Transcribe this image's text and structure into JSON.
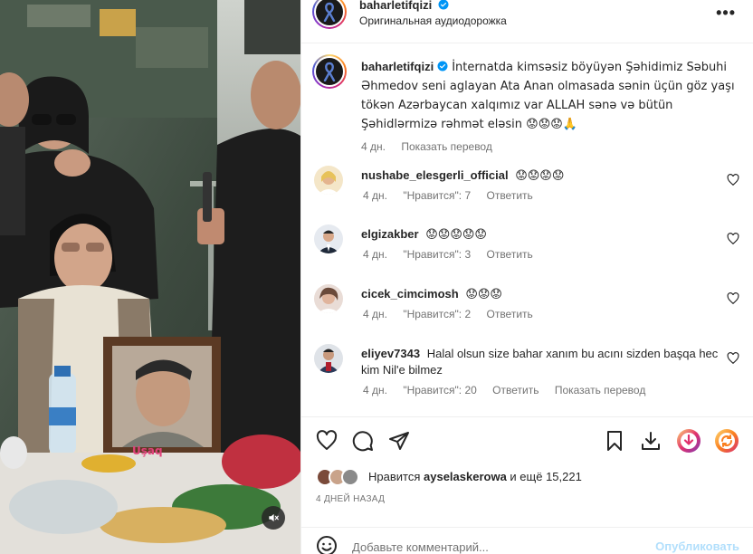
{
  "header": {
    "username": "baharletifqizi",
    "audio": "Оригинальная аудиодорожка",
    "more_label": "•••"
  },
  "caption": {
    "username": "baharletifqizi",
    "text": "İnternatda kimsəsiz böyüyən Şəhidimiz Səbuhi Əhmedov seni aglayan Ata Anan olmasada sənin üçün göz yaşı tökən Azərbaycan xalqımız var ALLAH sənə və bütün Şəhidlərmizə rəhmət eləsin 😟😟😟🙏",
    "age": "4 дн.",
    "translate": "Показать перевод"
  },
  "comments": [
    {
      "username": "nushabe_elesgerli_official",
      "text": "😟😟😟😟",
      "age": "4 дн.",
      "likes": "\"Нравится\": 7",
      "reply": "Ответить"
    },
    {
      "username": "elgizakber",
      "text": "😟😟😟😟😟",
      "age": "4 дн.",
      "likes": "\"Нравится\": 3",
      "reply": "Ответить"
    },
    {
      "username": "cicek_cimcimosh",
      "text": "😟😟😟",
      "age": "4 дн.",
      "likes": "\"Нравится\": 2",
      "reply": "Ответить"
    },
    {
      "username": "eliyev7343",
      "text": "Halal olsun size bahar xanım bu acını sizden başqa hec kim Nil'e bilmez",
      "age": "4 дн.",
      "likes": "\"Нравится\": 20",
      "reply": "Ответить",
      "translate": "Показать перевод"
    }
  ],
  "likes": {
    "prefix": "Нравится",
    "user": "ayselaskerowa",
    "suffix": "и ещё 15,221"
  },
  "post_date": "4 ДНЕЙ НАЗАД",
  "comment_box": {
    "placeholder": "Добавьте комментарий...",
    "publish": "Опубликовать"
  },
  "media": {
    "frame_caption": "Uşaq"
  },
  "icons": {
    "like": "heart-icon",
    "comment": "comment-icon",
    "share": "send-icon",
    "save": "bookmark-icon",
    "download": "download-icon",
    "extension_download": "download-circle-icon",
    "extension_refresh": "refresh-circle-icon",
    "mute": "mute-icon",
    "emoji": "emoji-icon",
    "more": "more-icon",
    "verified": "verified-badge-icon"
  },
  "colors": {
    "verified": "#0095f6",
    "publish_disabled": "#b2dffc",
    "secondary_text": "#737373",
    "extension_accent": "#e1306c"
  }
}
